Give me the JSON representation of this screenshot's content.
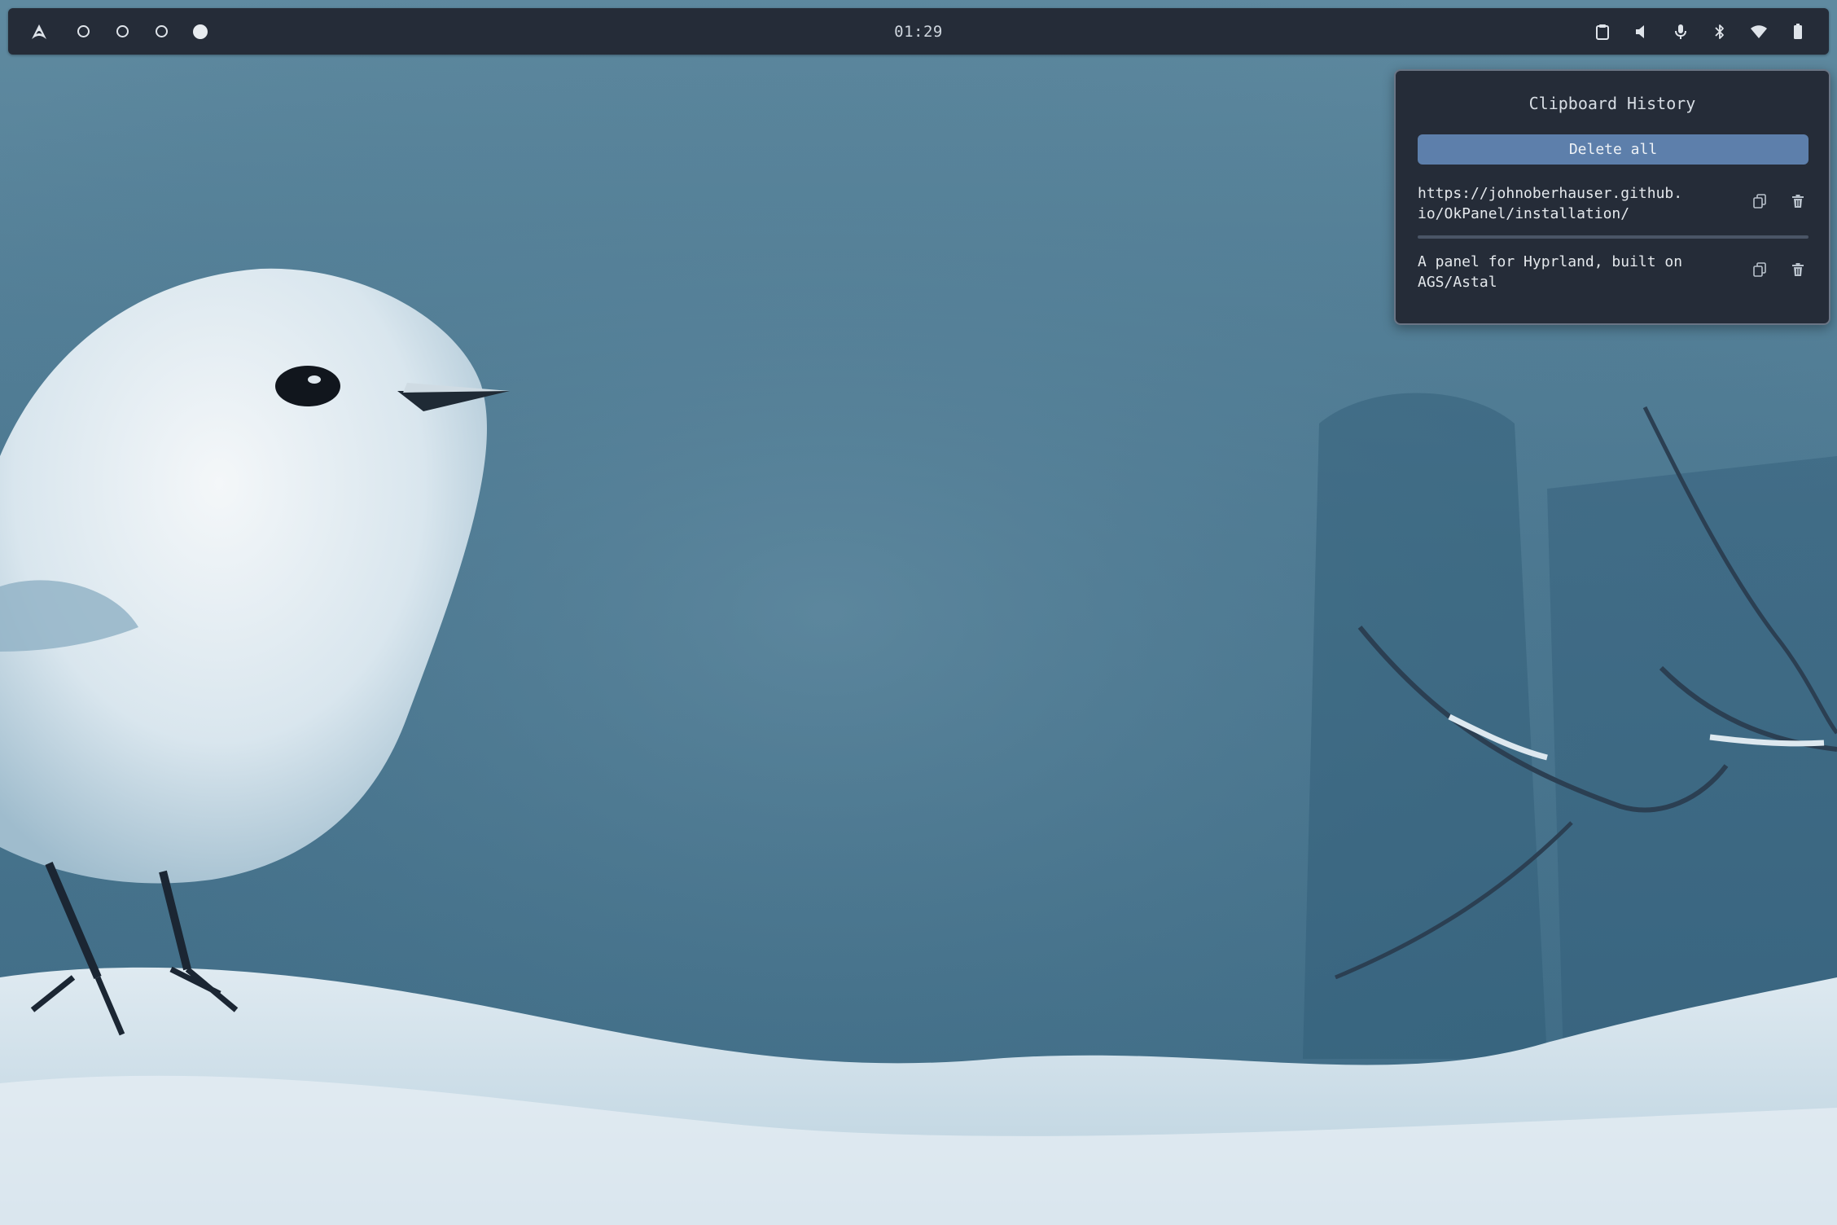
{
  "topbar": {
    "launcher_icon": "arch-logo-icon",
    "workspaces": [
      {
        "name": "workspace-1",
        "state": "empty"
      },
      {
        "name": "workspace-2",
        "state": "empty"
      },
      {
        "name": "workspace-3",
        "state": "empty"
      },
      {
        "name": "workspace-4",
        "state": "active"
      }
    ],
    "clock": "01:29",
    "tray_icons": [
      "clipboard-icon",
      "volume-icon",
      "microphone-icon",
      "bluetooth-icon",
      "wifi-icon",
      "battery-icon"
    ]
  },
  "clipboard": {
    "title": "Clipboard History",
    "delete_all_label": "Delete all",
    "entries": [
      {
        "text": "https://johnoberhauser.github.\nio/OkPanel/installation/"
      },
      {
        "text": "A panel for Hyprland, built on\nAGS/Astal"
      }
    ]
  },
  "colors": {
    "bar_bg": "#252c38",
    "accent": "#5d7fab",
    "text": "#e4e8ec"
  }
}
